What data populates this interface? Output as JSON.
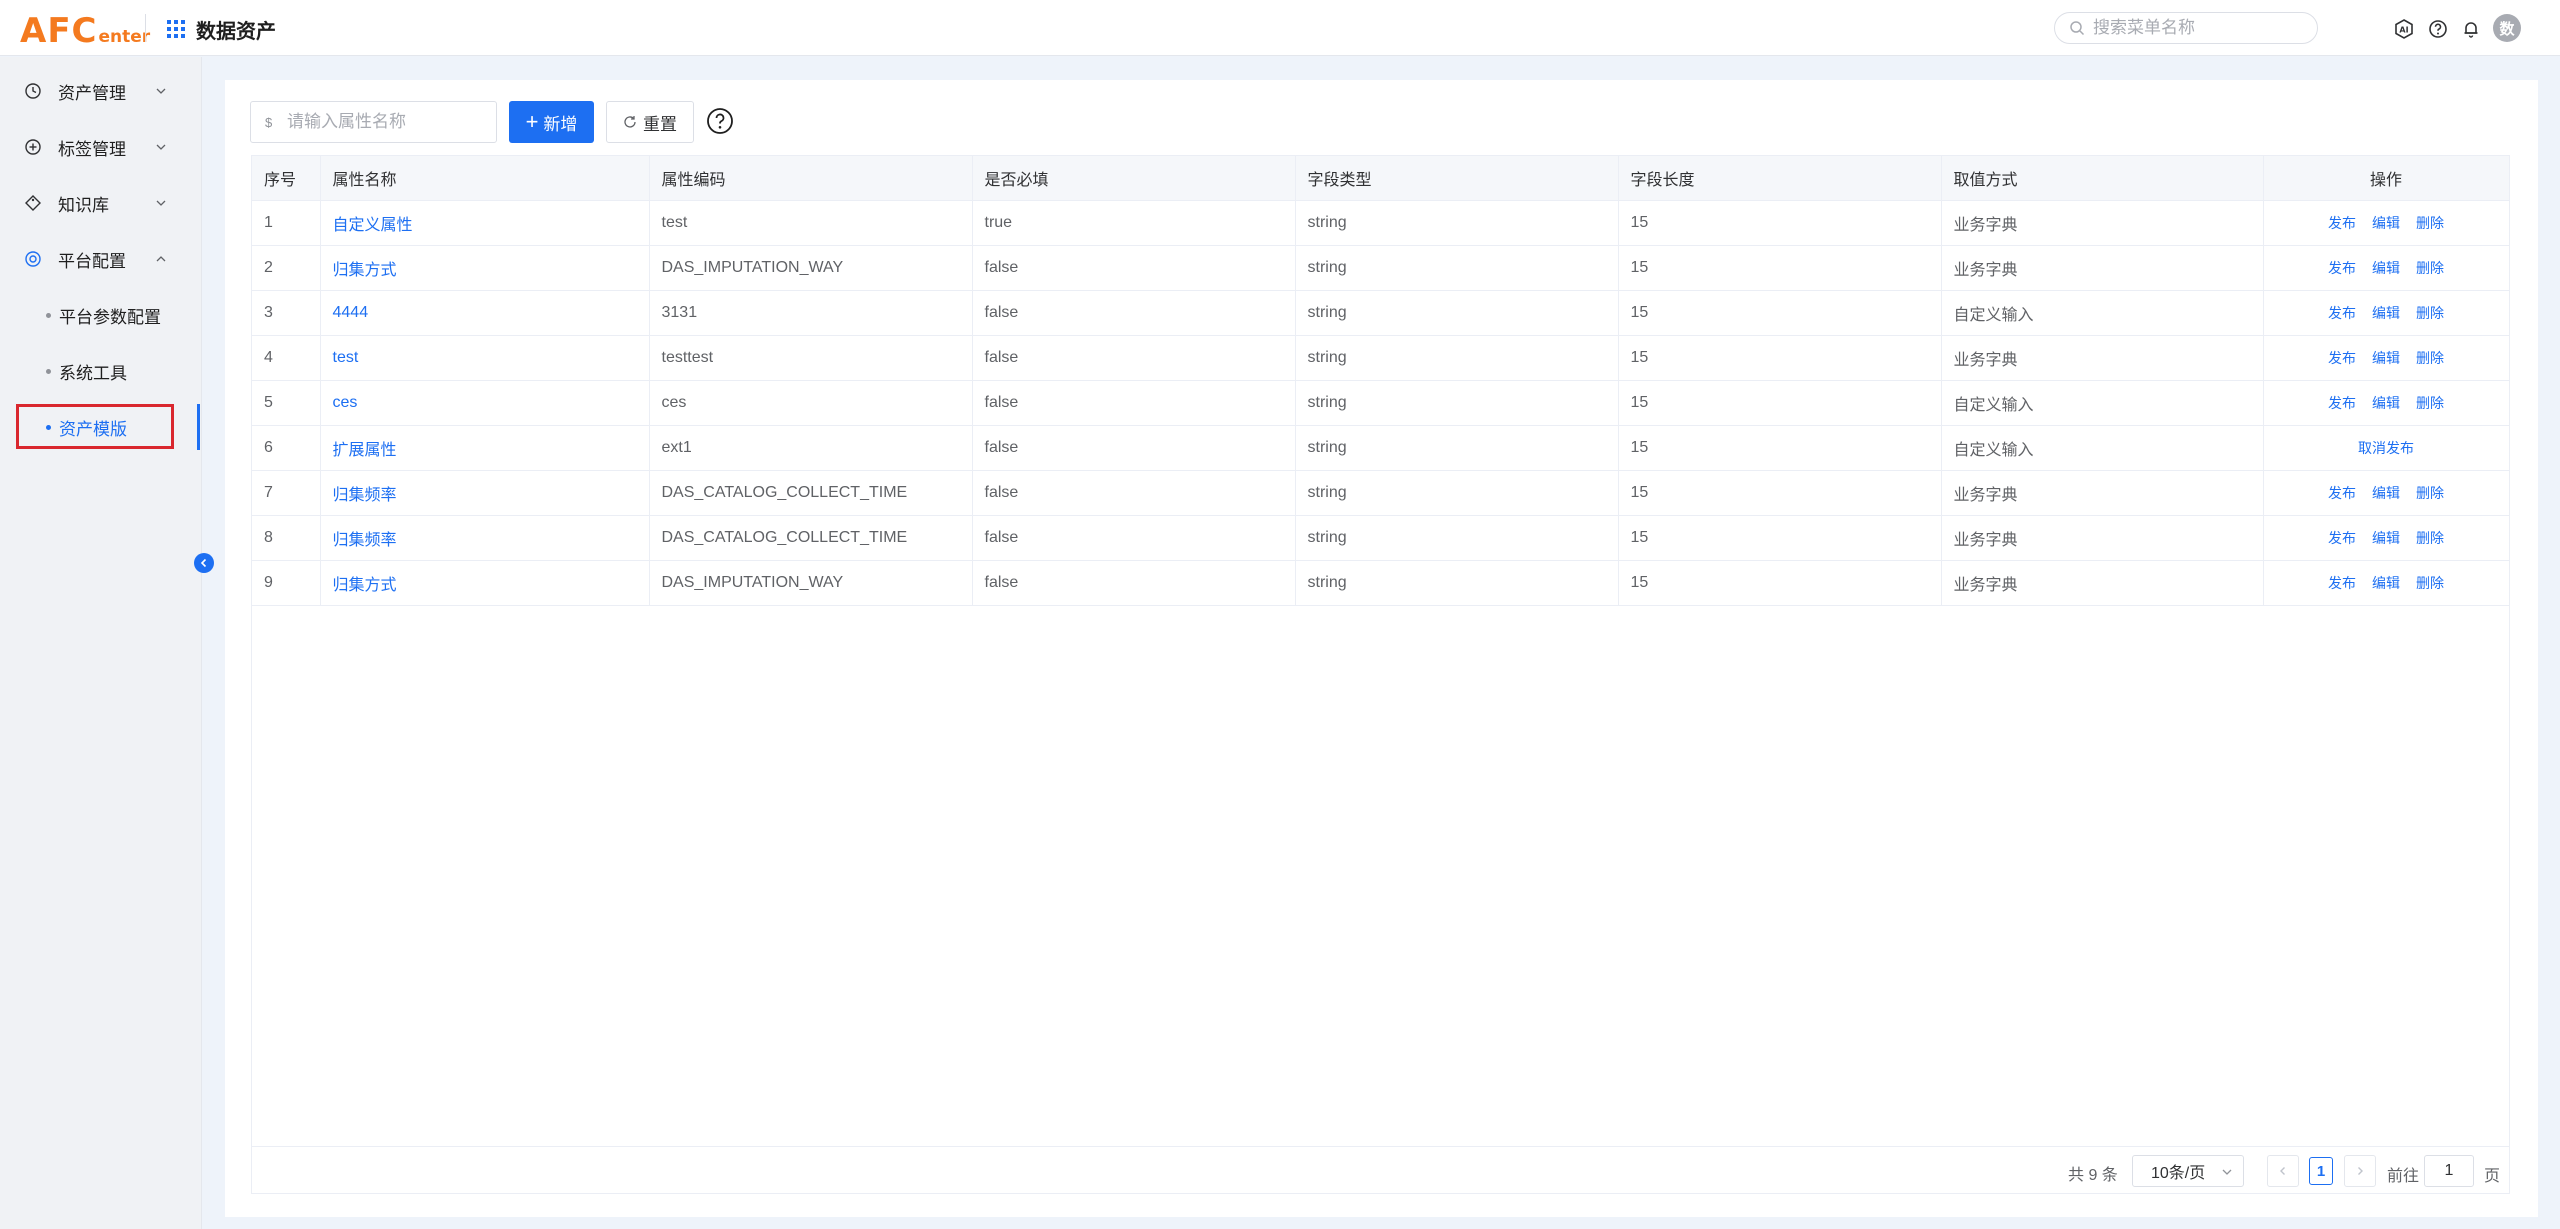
{
  "header": {
    "logo_big": "AFC",
    "logo_small": "enter",
    "app_title": "数据资产",
    "search_placeholder": "搜索菜单名称",
    "avatar_text": "数"
  },
  "sidebar": {
    "items": [
      {
        "label": "资产管理",
        "icon": "clock-icon"
      },
      {
        "label": "标签管理",
        "icon": "plus-circle-icon"
      },
      {
        "label": "知识库",
        "icon": "tag-icon"
      },
      {
        "label": "平台配置",
        "icon": "target-icon"
      }
    ],
    "sub_items": [
      {
        "label": "平台参数配置"
      },
      {
        "label": "系统工具"
      },
      {
        "label": "资产模版"
      }
    ]
  },
  "toolbar": {
    "attr_placeholder": "请输入属性名称",
    "add_label": "新增",
    "reset_label": "重置"
  },
  "table": {
    "headers": [
      "序号",
      "属性名称",
      "属性编码",
      "是否必填",
      "字段类型",
      "字段长度",
      "取值方式",
      "操作"
    ],
    "rows": [
      {
        "idx": "1",
        "name": "自定义属性",
        "code": "test",
        "required": "true",
        "type": "string",
        "len": "15",
        "mode": "业务字典",
        "ops": [
          "发布",
          "编辑",
          "删除"
        ]
      },
      {
        "idx": "2",
        "name": "归集方式",
        "code": "DAS_IMPUTATION_WAY",
        "required": "false",
        "type": "string",
        "len": "15",
        "mode": "业务字典",
        "ops": [
          "发布",
          "编辑",
          "删除"
        ]
      },
      {
        "idx": "3",
        "name": "4444",
        "code": "3131",
        "required": "false",
        "type": "string",
        "len": "15",
        "mode": "自定义输入",
        "ops": [
          "发布",
          "编辑",
          "删除"
        ]
      },
      {
        "idx": "4",
        "name": "test",
        "code": "testtest",
        "required": "false",
        "type": "string",
        "len": "15",
        "mode": "业务字典",
        "ops": [
          "发布",
          "编辑",
          "删除"
        ]
      },
      {
        "idx": "5",
        "name": "ces",
        "code": "ces",
        "required": "false",
        "type": "string",
        "len": "15",
        "mode": "自定义输入",
        "ops": [
          "发布",
          "编辑",
          "删除"
        ]
      },
      {
        "idx": "6",
        "name": "扩展属性",
        "code": "ext1",
        "required": "false",
        "type": "string",
        "len": "15",
        "mode": "自定义输入",
        "ops": [
          "取消发布"
        ]
      },
      {
        "idx": "7",
        "name": "归集频率",
        "code": "DAS_CATALOG_COLLECT_TIME",
        "required": "false",
        "type": "string",
        "len": "15",
        "mode": "业务字典",
        "ops": [
          "发布",
          "编辑",
          "删除"
        ]
      },
      {
        "idx": "8",
        "name": "归集频率",
        "code": "DAS_CATALOG_COLLECT_TIME",
        "required": "false",
        "type": "string",
        "len": "15",
        "mode": "业务字典",
        "ops": [
          "发布",
          "编辑",
          "删除"
        ]
      },
      {
        "idx": "9",
        "name": "归集方式",
        "code": "DAS_IMPUTATION_WAY",
        "required": "false",
        "type": "string",
        "len": "15",
        "mode": "业务字典",
        "ops": [
          "发布",
          "编辑",
          "删除"
        ]
      }
    ]
  },
  "pagination": {
    "total_text": "共 9 条",
    "page_size": "10条/页",
    "current_page": "1",
    "goto_label": "前往",
    "goto_value": "1",
    "page_unit": "页"
  },
  "colors": {
    "primary": "#1d6ff2",
    "logo": "#f47a1f",
    "highlight": "#d9272e"
  }
}
